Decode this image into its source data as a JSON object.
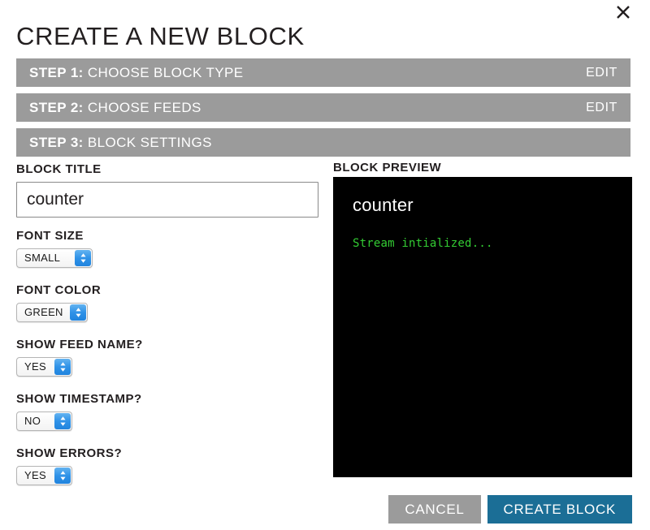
{
  "modal": {
    "title": "CREATE A NEW BLOCK",
    "close_icon": "close-icon"
  },
  "steps": [
    {
      "number": "STEP 1:",
      "label": " CHOOSE BLOCK TYPE",
      "action": "EDIT",
      "active": false
    },
    {
      "number": "STEP 2:",
      "label": " CHOOSE FEEDS",
      "action": "EDIT",
      "active": false
    },
    {
      "number": "STEP 3:",
      "label": " BLOCK SETTINGS",
      "action": "",
      "active": true
    }
  ],
  "settings": {
    "block_title": {
      "label": "BLOCK TITLE",
      "value": "counter",
      "placeholder": ""
    },
    "font_size": {
      "label": "FONT SIZE",
      "value": "SMALL"
    },
    "font_color": {
      "label": "FONT COLOR",
      "value": "GREEN"
    },
    "show_feed_name": {
      "label": "SHOW FEED NAME?",
      "value": "YES"
    },
    "show_timestamp": {
      "label": "SHOW TIMESTAMP?",
      "value": "NO"
    },
    "show_errors": {
      "label": "SHOW ERRORS?",
      "value": "YES"
    }
  },
  "preview": {
    "label": "BLOCK PREVIEW",
    "title": "counter",
    "line": "Stream intialized...",
    "line_color": "#33cc33",
    "background": "#000000"
  },
  "footer": {
    "cancel_label": "CANCEL",
    "create_label": "CREATE BLOCK"
  },
  "colors": {
    "step_bar_gray": "#9b9b9b",
    "primary_blue": "#1b6e96",
    "cancel_gray": "#9b9b9b",
    "stepper_blue": "#2f92e8"
  }
}
